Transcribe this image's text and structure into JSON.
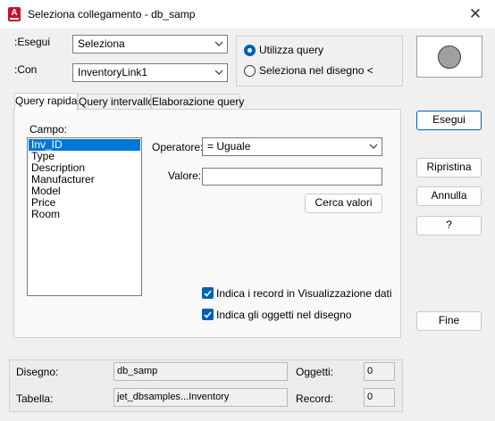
{
  "window": {
    "title": "Seleziona collegamento - db_samp",
    "app_icon_letter": "A",
    "close_glyph": "✕"
  },
  "top": {
    "esegui_label": ":Esegui",
    "esegui_value": "Seleziona",
    "con_label": ":Con",
    "con_value": "InventoryLink1",
    "radio_query_label": "Utilizza query",
    "radio_select_label": "Seleziona nel disegno <",
    "radio_query_selected": true
  },
  "tabs": [
    {
      "label": "Query rapida",
      "active": true
    },
    {
      "label": "Query intervallo",
      "active": false
    },
    {
      "label": "Elaborazione query",
      "active": false
    }
  ],
  "campo": {
    "label": "Campo:",
    "items": [
      "Inv_ID",
      "Type",
      "Description",
      "Manufacturer",
      "Model",
      "Price",
      "Room"
    ],
    "selected": "Inv_ID"
  },
  "operatore": {
    "label": "Operatore:",
    "value": "=   Uguale"
  },
  "valore": {
    "label": "Valore:",
    "value": ""
  },
  "buttons": {
    "cerca_valori": "Cerca valori",
    "esegui": "Esegui",
    "ripristina": "Ripristina",
    "annulla": "Annulla",
    "help": "?",
    "fine": "Fine"
  },
  "checkboxes": [
    {
      "label": "Indica i record in Visualizzazione dati",
      "checked": true
    },
    {
      "label": "Indica gli oggetti nel disegno",
      "checked": true
    }
  ],
  "status": {
    "disegno_label": "Disegno:",
    "disegno_value": "db_samp",
    "tabella_label": "Tabella:",
    "tabella_value": "jet_dbsamples...Inventory",
    "oggetti_label": "Oggetti:",
    "oggetti_value": "0",
    "record_label": "Record:",
    "record_value": "0"
  },
  "colors": {
    "accent": "#005fb8",
    "selection": "#0078d7",
    "app_icon": "#c8102e"
  },
  "icons": [
    "autocad-app-icon",
    "close-icon",
    "chevron-down-icon",
    "check-icon",
    "circle-preview-icon"
  ]
}
